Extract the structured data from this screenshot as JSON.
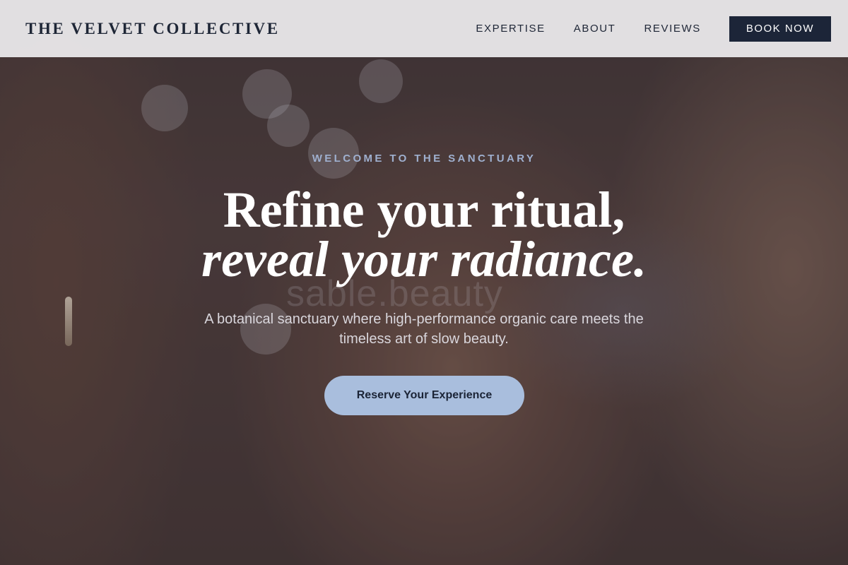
{
  "brand": {
    "name": "THE VELVET COLLECTIVE"
  },
  "nav": {
    "links": [
      "EXPERTISE",
      "ABOUT",
      "REVIEWS"
    ],
    "cta_label": "BOOK NOW"
  },
  "hero": {
    "eyebrow": "WELCOME TO THE SANCTUARY",
    "headline_line1": "Refine your ritual,",
    "headline_line2": "reveal your radiance.",
    "subcopy": "A botanical sanctuary where high-performance organic care meets the timeless art of slow beauty.",
    "cta_label": "Reserve Your Experience",
    "watermark": "sable.beauty"
  },
  "colors": {
    "nav_bg": "#e8e6e8",
    "brand_text": "#1e2636",
    "book_button_bg": "#1c2538",
    "eyebrow_text": "#9fb0cf",
    "cta_bg": "#a9bedd",
    "cta_text": "#1b2436"
  }
}
